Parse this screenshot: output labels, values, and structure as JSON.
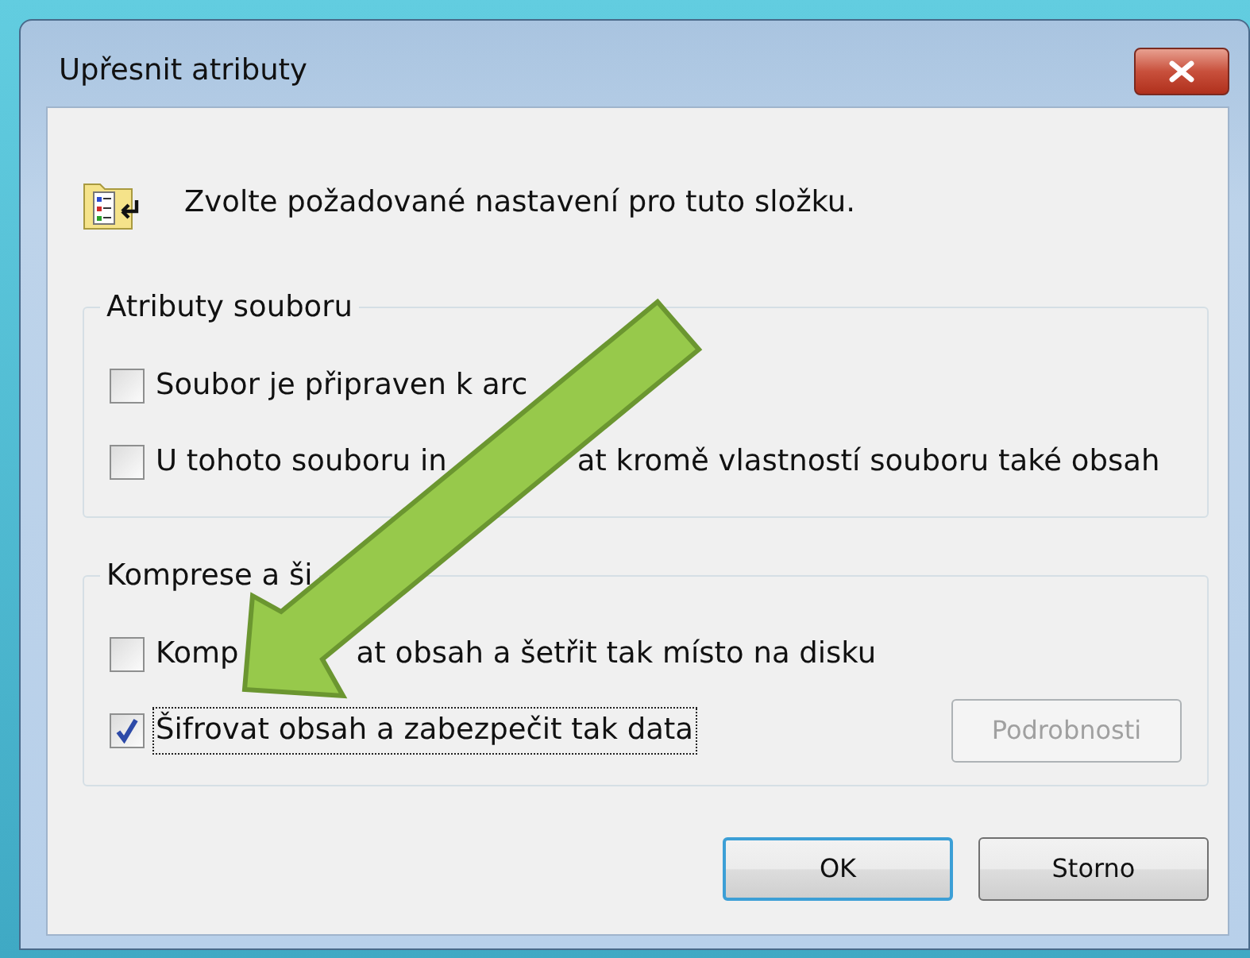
{
  "window": {
    "title": "Upřesnit atributy"
  },
  "intro": {
    "text": "Zvolte požadované nastavení pro tuto složku."
  },
  "groups": [
    {
      "title_parts": [
        "Atributy souboru"
      ],
      "options": [
        {
          "label_parts": [
            "Soubor je připraven k arc"
          ],
          "checked": false,
          "focused": false
        },
        {
          "label_parts": [
            "U tohoto souboru in",
            "at kromě vlastností souboru také obsah"
          ],
          "checked": false,
          "focused": false
        }
      ]
    },
    {
      "title_parts": [
        "Komprese a ši"
      ],
      "options": [
        {
          "label_parts": [
            "Komp",
            "at obsah a šetřit tak místo na disku"
          ],
          "checked": false,
          "focused": false
        },
        {
          "label_parts": [
            "Šifrovat obsah a zabezpečit tak data"
          ],
          "checked": true,
          "focused": true
        }
      ],
      "button": {
        "label": "Podrobnosti",
        "disabled": true
      }
    }
  ],
  "buttons": [
    {
      "label": "OK",
      "default": true
    },
    {
      "label": "Storno",
      "default": false
    }
  ]
}
